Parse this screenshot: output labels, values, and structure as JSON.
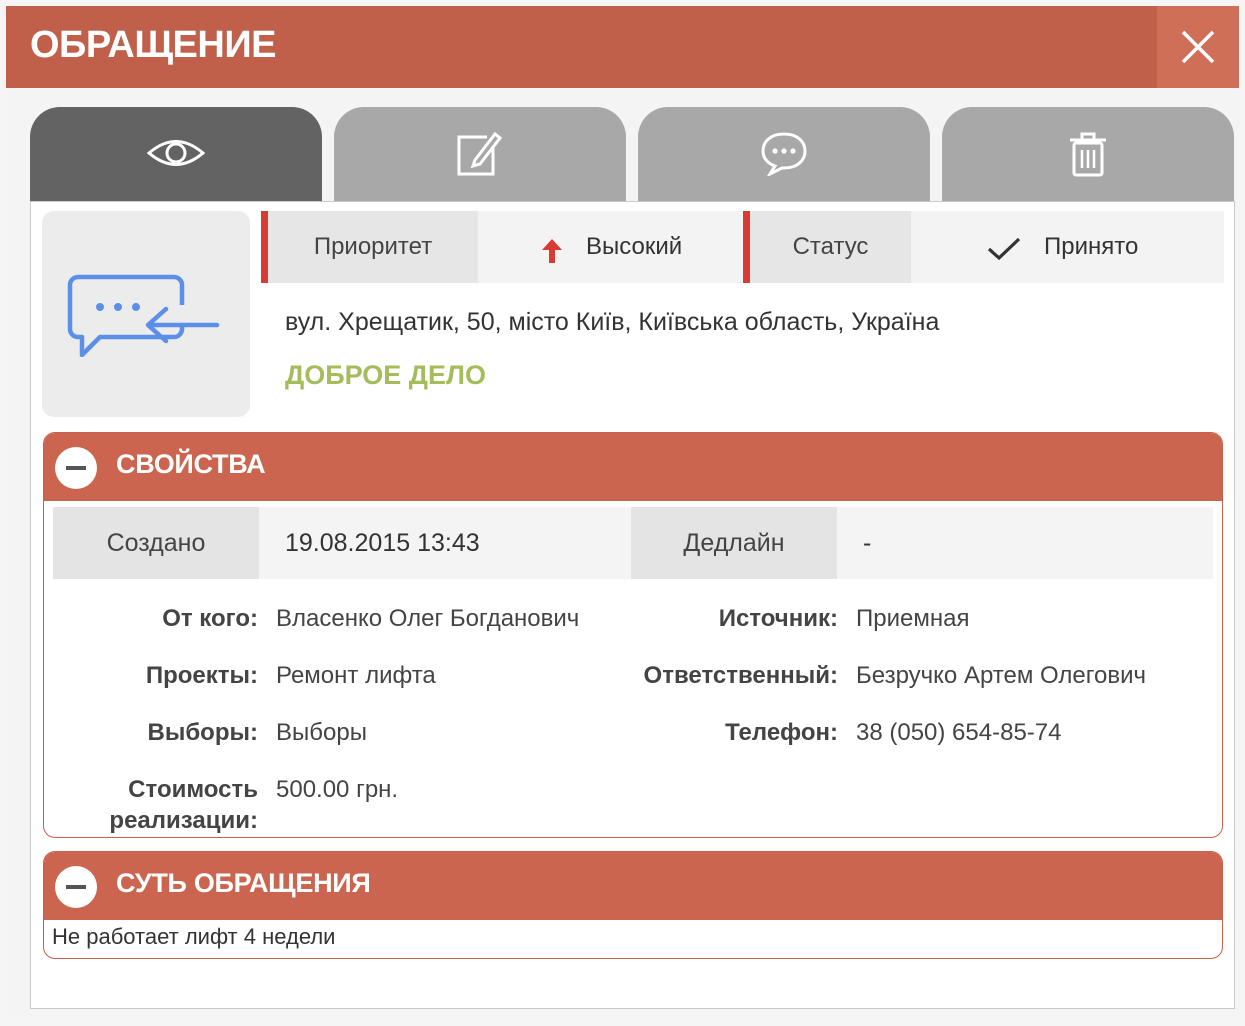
{
  "modal": {
    "title": "ОБРАЩЕНИЕ",
    "close_icon": "close-icon",
    "accent_color": "#c0604a"
  },
  "tabs": [
    {
      "name": "view",
      "icon": "eye-icon",
      "active": true
    },
    {
      "name": "edit",
      "icon": "edit-icon",
      "active": false
    },
    {
      "name": "comments",
      "icon": "chat-icon",
      "active": false
    },
    {
      "name": "delete",
      "icon": "trash-icon",
      "active": false
    }
  ],
  "request": {
    "icon": "incoming-message-icon",
    "priority_label": "Приоритет",
    "priority_value": "Высокий",
    "priority_icon": "arrow-up-icon",
    "status_label": "Статус",
    "status_value": "Принято",
    "status_icon": "check-icon",
    "address": "вул. Хрещатик, 50, місто Київ, Київська область, Україна",
    "category": "ДОБРОЕ ДЕЛО"
  },
  "properties": {
    "title": "СВОЙСТВА",
    "created_label": "Создано",
    "created_value": "19.08.2015 13:43",
    "deadline_label": "Дедлайн",
    "deadline_value": "-",
    "from_label": "От кого:",
    "from_value": "Власенко Олег Богданович",
    "source_label": "Источник:",
    "source_value": "Приемная",
    "projects_label": "Проекты:",
    "projects_value": "Ремонт лифта",
    "responsible_label": "Ответственный:",
    "responsible_value": "Безручко Артем Олегович",
    "elections_label": "Выборы:",
    "elections_value": "Выборы",
    "phone_label": "Телефон:",
    "phone_value": "38 (050) 654-85-74",
    "cost_label_line1": "Стоимость",
    "cost_label_line2": "реализации:",
    "cost_value": "500.00 грн."
  },
  "essence": {
    "title": "СУТЬ ОБРАЩЕНИЯ",
    "text": "Не работает лифт 4 недели"
  }
}
